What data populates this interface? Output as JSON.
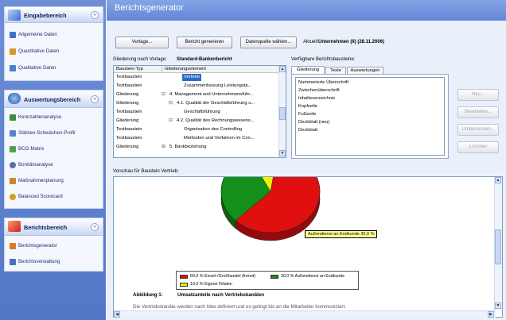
{
  "nav": {
    "sections": [
      {
        "title": "Eingabebereich",
        "items": [
          "Allgemeine Daten",
          "Quantitative Daten",
          "Qualitative Daten"
        ]
      },
      {
        "title": "Auswertungsbereich",
        "items": [
          "Kennzahlenanalyse",
          "Stärken-Schwächen-Profil",
          "BCG-Matrix",
          "Bonitätsanalyse",
          "Maßnahmenplanung",
          "Balanced Scorecard"
        ]
      },
      {
        "title": "Berichtsbereich",
        "items": [
          "Berichtsgenerator",
          "Berichtsverwaltung"
        ]
      }
    ],
    "collapse_glyph": "«"
  },
  "main": {
    "title": "Berichtsgenerator",
    "toolbar": {
      "vorlage": "Vorlage...",
      "generate": "Bericht generieren",
      "datasource": "Datenquelle wählen...",
      "current_label": "Aktuell:",
      "current_value": "Unternehmen (II) (28.11.2006)"
    },
    "outline": {
      "label": "Gliederung nach Vorlage:",
      "template_name": "Standard-Bankenbericht",
      "col_type": "Baustein-Typ",
      "col_element": "Gliederungselement",
      "rows": [
        {
          "type": "Textbaustein",
          "element": "Vertrieb",
          "indent": 3,
          "selected": true,
          "expander": ""
        },
        {
          "type": "Textbaustein",
          "element": "Zusammenfassung Leistungsta...",
          "indent": 3,
          "selected": false,
          "expander": ""
        },
        {
          "type": "Gliederung",
          "element": "4. Management und Unternehmensführ...",
          "indent": 1,
          "selected": false,
          "expander": "⊟"
        },
        {
          "type": "Gliederung",
          "element": "4.1. Qualität der Geschäftsführung u...",
          "indent": 2,
          "selected": false,
          "expander": "⊟"
        },
        {
          "type": "Textbaustein",
          "element": "Geschäftsführung",
          "indent": 3,
          "selected": false,
          "expander": ""
        },
        {
          "type": "Gliederung",
          "element": "4.2. Qualität des Rechnungswesens...",
          "indent": 2,
          "selected": false,
          "expander": "⊟"
        },
        {
          "type": "Textbaustein",
          "element": "Organisation des Controlling",
          "indent": 3,
          "selected": false,
          "expander": ""
        },
        {
          "type": "Textbaustein",
          "element": "Methoden und Verfahren im Con...",
          "indent": 3,
          "selected": false,
          "expander": ""
        },
        {
          "type": "Gliederung",
          "element": "5. Bankbeziehung",
          "indent": 1,
          "selected": false,
          "expander": "⊞"
        }
      ]
    },
    "available": {
      "label": "Verfügbare Berichtsbausteine:",
      "tabs": [
        "Gliederung",
        "Texte",
        "Auswertungen"
      ],
      "active_tab": 0,
      "items": [
        "Nummerierte Überschrift",
        "Zwischenüberschrift",
        "Inhaltsverzeichnis",
        "Kopfzeile",
        "Fußzeile",
        "Deckblatt (neu)",
        "Deckblatt"
      ],
      "side_buttons": [
        "Neu...",
        "Bearbeiten...",
        "Umbenennen...",
        "Löschen"
      ]
    },
    "preview": {
      "label": "Vorschau für Baustein Vertrieb:",
      "callout": "Außendienst an Endkunde 30,0 %",
      "legend": [
        {
          "label": "60,0 % Einzel-/Großhandel (fremd)",
          "color": "#e01010"
        },
        {
          "label": "30,0 % Außendienst an Endkunde",
          "color": "#13901a"
        },
        {
          "label": "10,0 % Eigene Filialen",
          "color": "#f4f000"
        }
      ],
      "caption_label": "Abbildung 1:",
      "caption_text": "Umsatzanteile nach Vertriebskanälen",
      "body_text": "Die Vertriebskanäle werden nach Idee definiert und es gelingt bis an die Mitarbeiter kommuniziert."
    }
  },
  "colors": {
    "accent": "#6286d6",
    "selection": "#316ac5"
  },
  "chart_data": {
    "type": "pie",
    "title": "",
    "categories": [
      "Einzel-/Großhandel (fremd)",
      "Außendienst an Endkunde",
      "Eigene Filialen"
    ],
    "values": [
      60,
      30,
      10
    ],
    "colors": [
      "#e01010",
      "#13901a",
      "#f4f000"
    ]
  }
}
